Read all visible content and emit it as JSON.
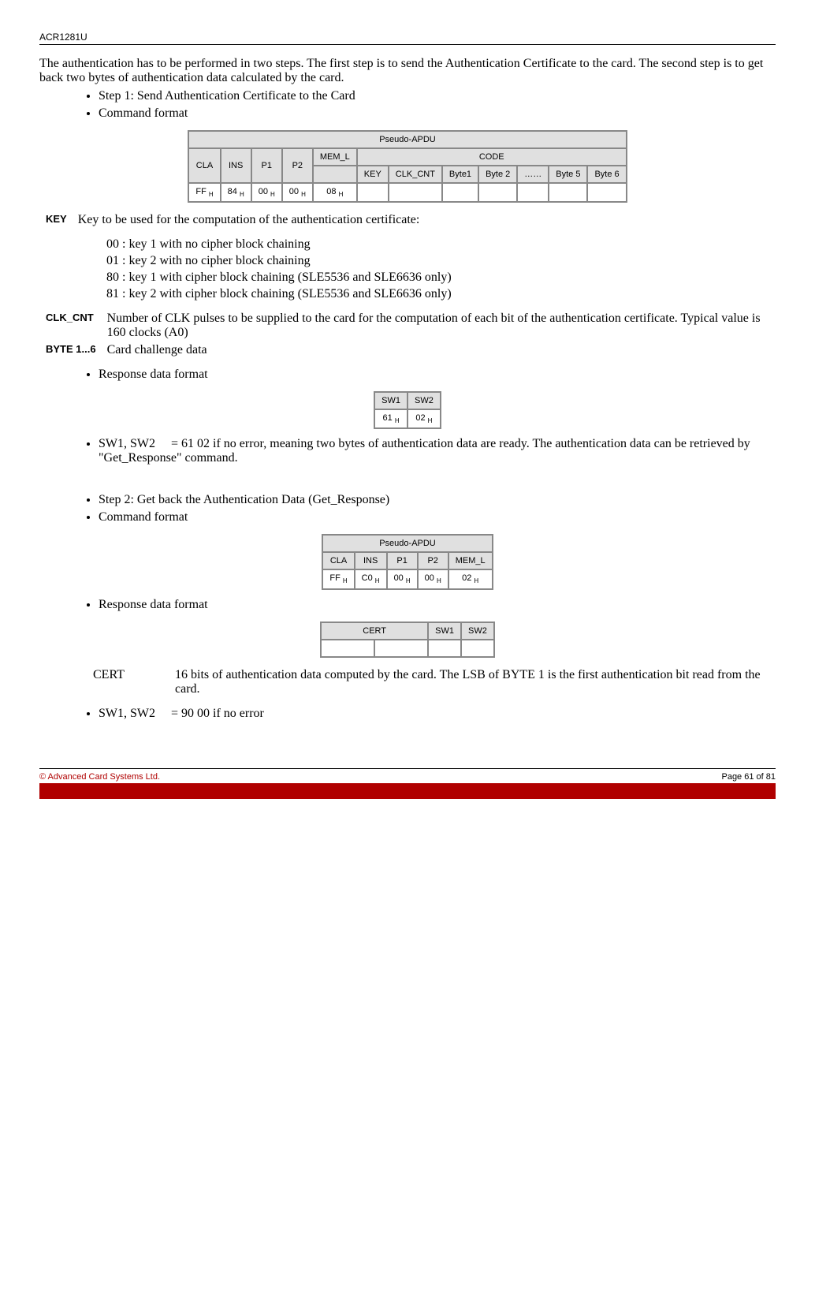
{
  "header": {
    "title": "ACR1281U"
  },
  "intro": "The authentication has to be performed in two steps.  The first step is to send the Authentication Certificate to the card.  The second step is to get back two bytes of authentication data calculated by the card.",
  "bullets1": {
    "a": "Step 1: Send Authentication Certificate to the Card",
    "b": "Command format"
  },
  "t1": {
    "caption": "Pseudo-APDU",
    "h": {
      "cla": "CLA",
      "ins": "INS",
      "p1": "P1",
      "p2": "P2",
      "meml": "MEM_L",
      "code": "CODE",
      "key": "KEY",
      "clk": "CLK_CNT",
      "b1": "Byte1",
      "b2": "Byte 2",
      "dots": "……",
      "b5": "Byte 5",
      "b6": "Byte 6"
    },
    "r": {
      "cla": "FF ",
      "ins": "84 ",
      "p1": "00 ",
      "p2": "00 ",
      "meml": "08 "
    }
  },
  "defs": {
    "key_label": "KEY",
    "key_desc": "Key to be used for the computation of the authentication certificate:",
    "key_00": "00 :  key 1 with no cipher block chaining",
    "key_01": "01 :  key 2 with no cipher block chaining",
    "key_80": "80 :  key 1 with cipher block chaining (SLE5536 and SLE6636 only)",
    "key_81": "81 :  key 2 with cipher block chaining (SLE5536 and SLE6636 only)",
    "clk_label": "CLK_CNT",
    "clk_desc": "Number of CLK pulses to be supplied to the card for the computation of each bit of the authentication certificate.  Typical value is 160 clocks (A0)",
    "byte_label": "BYTE 1...6",
    "byte_desc": "Card challenge data"
  },
  "bullets2": {
    "a": "Response data format"
  },
  "t2": {
    "sw1": "SW1",
    "sw2": "SW2",
    "v1": "61 ",
    "v2": "02 "
  },
  "sw_line": {
    "a": "SW1, SW2",
    "b": "= 61  02  if no error, meaning two bytes of authentication data are ready. The authentication data can be retrieved by \"Get_Response\" command."
  },
  "bullets3": {
    "a": "Step 2: Get back the Authentication Data (Get_Response)",
    "b": "Command format"
  },
  "t3": {
    "caption": "Pseudo-APDU",
    "h": {
      "cla": "CLA",
      "ins": "INS",
      "p1": "P1",
      "p2": "P2",
      "meml": "MEM_L"
    },
    "r": {
      "cla": "FF ",
      "ins": "C0 ",
      "p1": "00 ",
      "p2": "00 ",
      "meml": "02 "
    }
  },
  "bullets4": {
    "a": "Response data format"
  },
  "t4": {
    "cert": "CERT",
    "sw1": "SW1",
    "sw2": "SW2"
  },
  "cert_line": {
    "a": "CERT",
    "b": "16 bits of authentication data computed by the card. The LSB of BYTE 1 is the first authentication bit read from the card."
  },
  "sw_line2": {
    "a": "SW1, SW2",
    "b": "= 90  00 if no error"
  },
  "footer": {
    "left": "© Advanced Card Systems Ltd.",
    "right": "Page 61 of 81"
  },
  "sub": "H"
}
